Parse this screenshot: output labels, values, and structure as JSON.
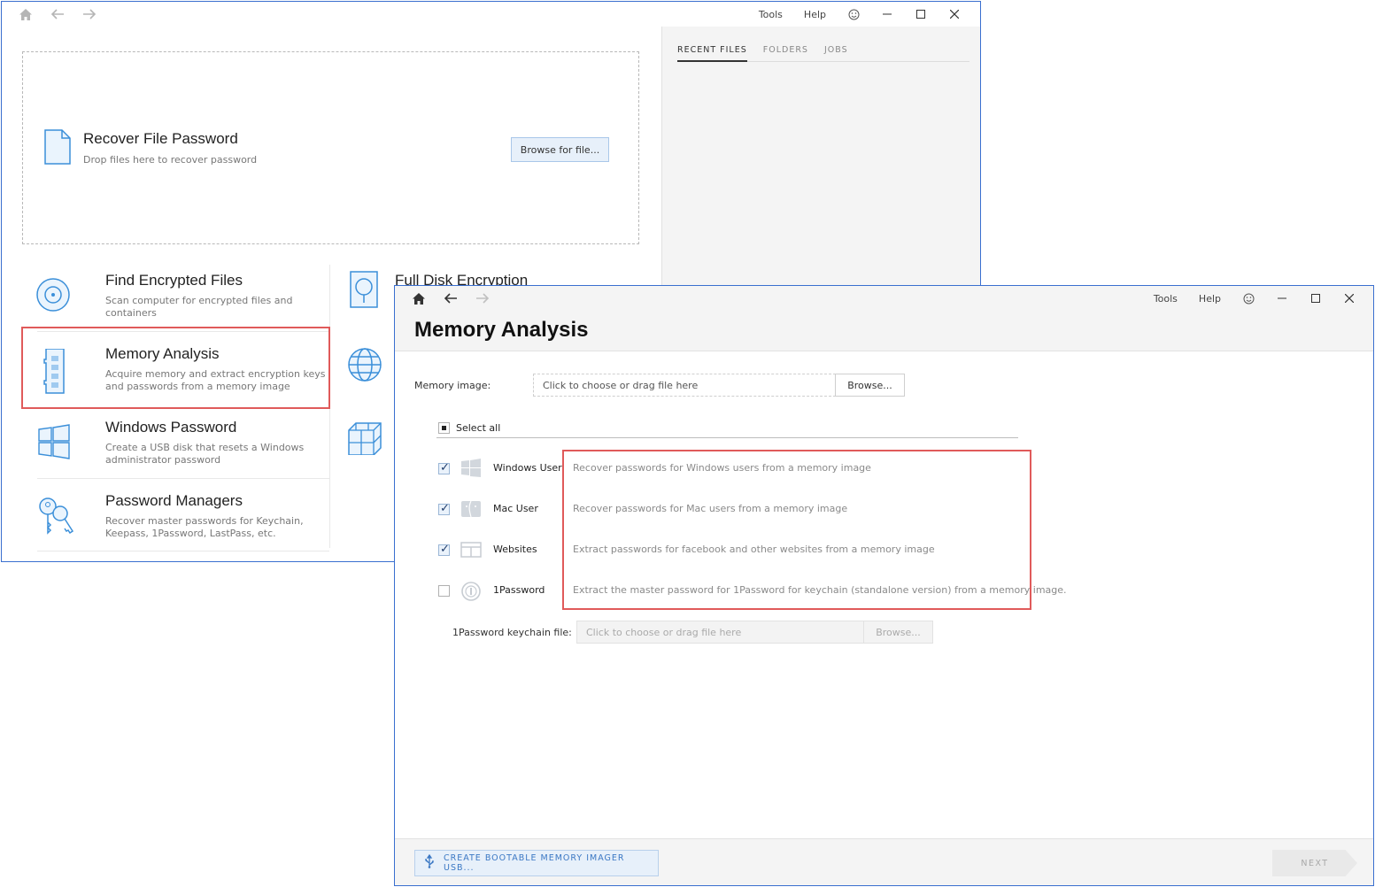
{
  "back_window": {
    "titlebar": {
      "tools": "Tools",
      "help": "Help"
    },
    "recover": {
      "title": "Recover File Password",
      "desc": "Drop files here to recover password",
      "browse_label": "Browse for file..."
    },
    "tabs": [
      "RECENT FILES",
      "FOLDERS",
      "JOBS"
    ],
    "tiles": [
      {
        "title": "Find Encrypted Files",
        "desc": "Scan computer for encrypted files and containers"
      },
      {
        "title": "Memory Analysis",
        "desc": "Acquire memory and extract encryption keys and passwords from a memory image"
      },
      {
        "title": "Windows Password",
        "desc": "Create a USB disk that resets a Windows administrator password"
      },
      {
        "title": "Password Managers",
        "desc": "Recover master passwords for Keychain, Keepass, 1Password, LastPass, etc."
      }
    ],
    "partial_tile_title": "Full Disk Encryption"
  },
  "front_window": {
    "titlebar": {
      "tools": "Tools",
      "help": "Help"
    },
    "title": "Memory Analysis",
    "memory_image": {
      "label": "Memory image:",
      "placeholder": "Click to choose or drag file here",
      "browse_label": "Browse..."
    },
    "select_all": "Select all",
    "options": [
      {
        "label": "Windows User",
        "desc": "Recover passwords for Windows users from a memory image",
        "checked": true,
        "icon": "windows-logo-icon"
      },
      {
        "label": "Mac User",
        "desc": "Recover passwords for Mac users from a memory image",
        "checked": true,
        "icon": "mac-finder-icon"
      },
      {
        "label": "Websites",
        "desc": "Extract passwords for facebook and other websites from a memory image",
        "checked": true,
        "icon": "browser-window-icon"
      },
      {
        "label": "1Password",
        "desc": "Extract the master password for 1Password for keychain (standalone version) from a memory image.",
        "checked": false,
        "icon": "onepassword-icon"
      }
    ],
    "keychain": {
      "label": "1Password keychain file:",
      "placeholder": "Click to choose or drag file here",
      "browse_label": "Browse..."
    },
    "footer": {
      "usb_label": "CREATE BOOTABLE MEMORY IMAGER USB...",
      "next_label": "NEXT"
    }
  },
  "colors": {
    "accent": "#3b8fd9",
    "highlight": "#e05a5a",
    "window_border": "#3a6fcf"
  }
}
